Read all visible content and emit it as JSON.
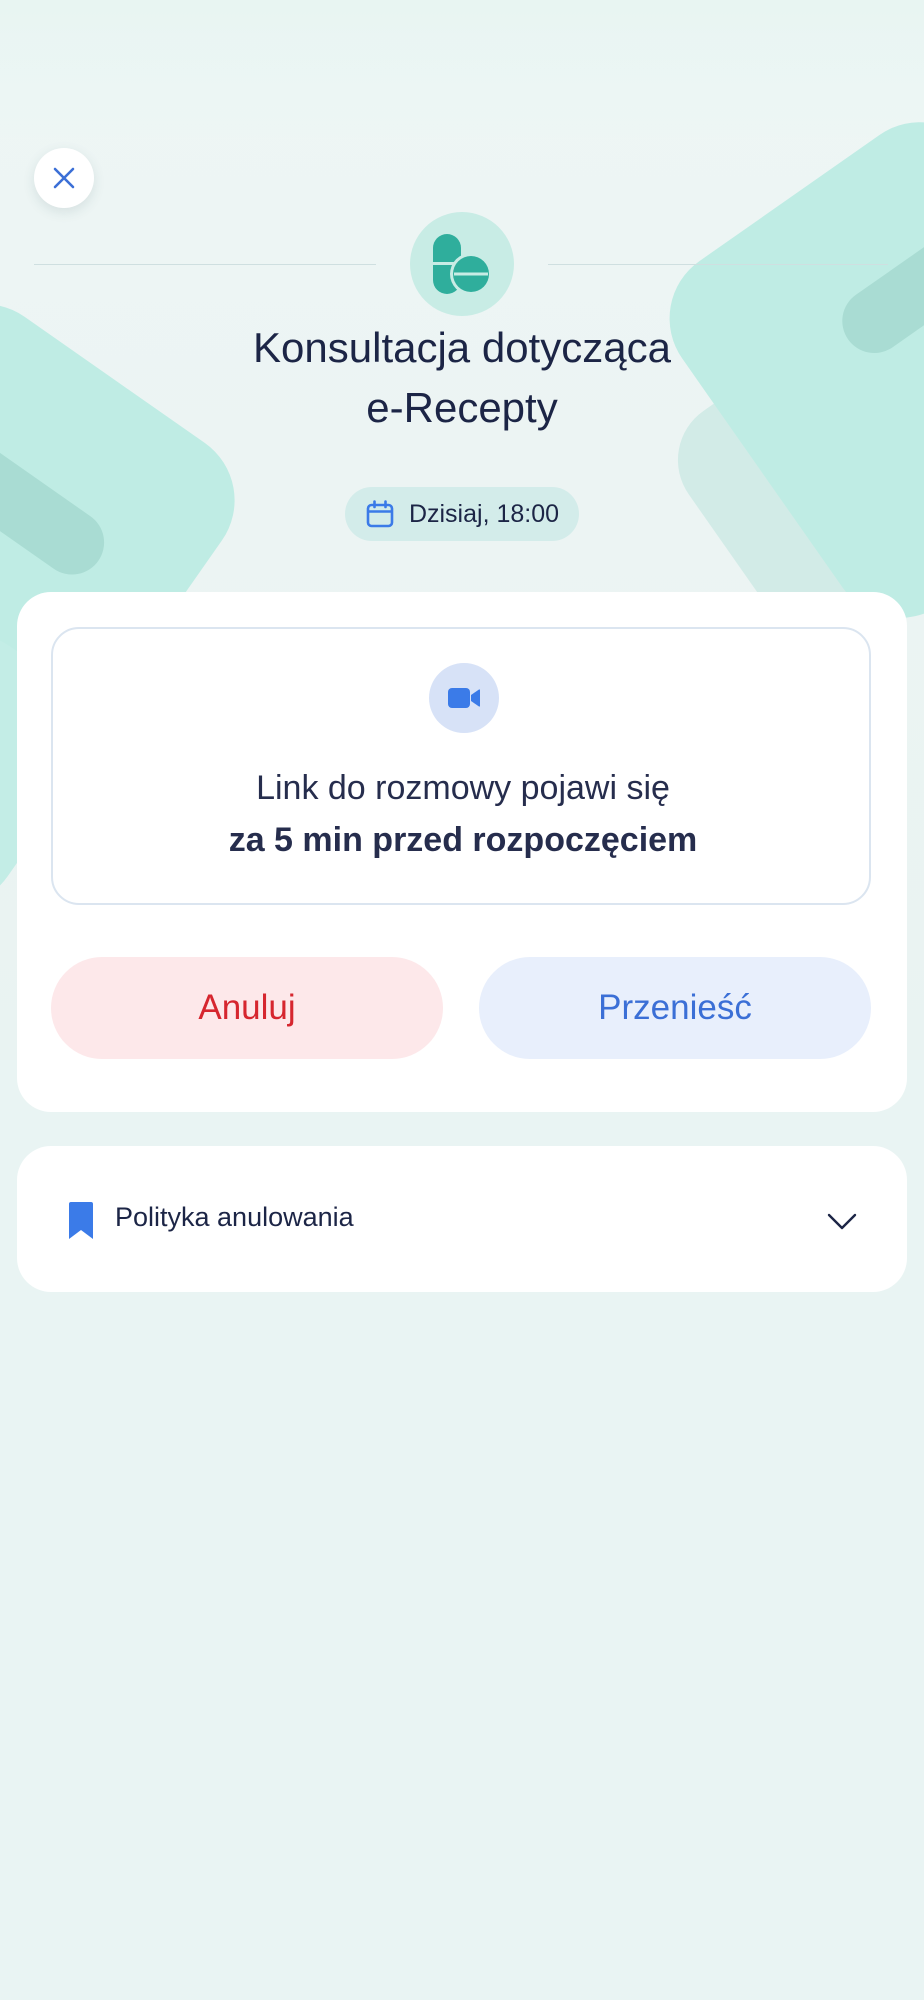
{
  "header": {
    "close_icon": "close-icon",
    "service_icon": "pills-icon",
    "title_line1": "Konsultacja dotycząca",
    "title_line2": "e-Recepty"
  },
  "appointment": {
    "date_icon": "calendar-icon",
    "date_text": "Dzisiaj, 18:00"
  },
  "info": {
    "icon": "video-camera-icon",
    "line1": "Link do rozmowy pojawi się",
    "line2": "za 5 min przed rozpoczęciem"
  },
  "actions": {
    "cancel_label": "Anuluj",
    "reschedule_label": "Przenieść"
  },
  "policy": {
    "icon": "bookmark-icon",
    "label": "Polityka anulowania",
    "expand_icon": "chevron-down-icon"
  },
  "colors": {
    "background": "#e9f4f3",
    "accent_teal": "#2fae9c",
    "accent_blue": "#3b7be8",
    "cancel_bg": "#fde8ea",
    "cancel_text": "#d6262f",
    "reschedule_bg": "#e8effc",
    "reschedule_text": "#3b6fd6",
    "title_text": "#1c2546"
  }
}
